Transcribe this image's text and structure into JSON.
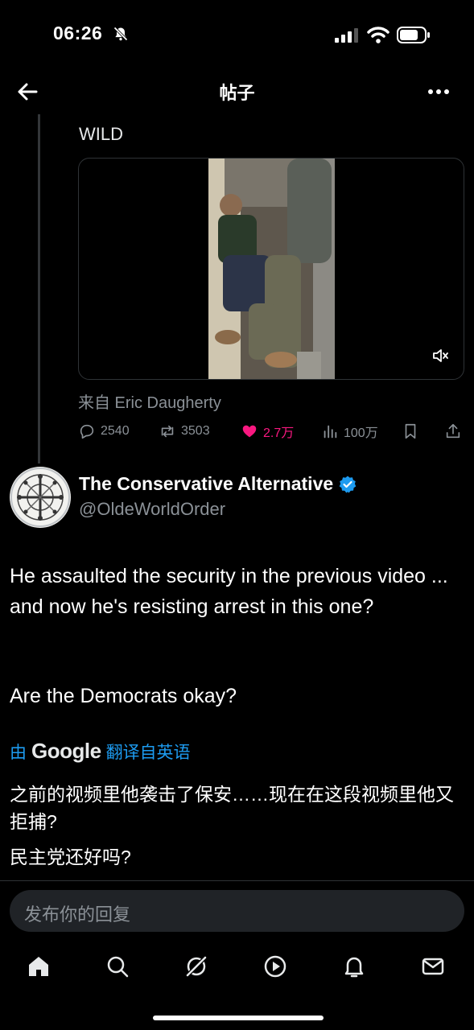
{
  "status": {
    "time": "06:26"
  },
  "header": {
    "title": "帖子"
  },
  "quoted_post": {
    "text": "WILD",
    "source": "来自 Eric Daugherty",
    "stats": {
      "replies": "2540",
      "reposts": "3503",
      "likes": "2.7万",
      "views": "100万"
    }
  },
  "post": {
    "author_name": "The Conservative Alternative",
    "author_handle": "@OldeWorldOrder",
    "body_p1": "He assaulted the security in the previous video ... and now he's resisting arrest in this one?",
    "body_p2": "Are the Democrats okay?",
    "translate_prefix": "由",
    "translate_brand": "Google",
    "translate_suffix": "翻译自英语",
    "translated_p1": "之前的视频里他袭击了保安……现在在这段视频里他又拒捕?",
    "translated_p2": "民主党还好吗?"
  },
  "reply": {
    "placeholder": "发布你的回复"
  },
  "colors": {
    "background": "#000000",
    "accent_blue": "#1d9bf0",
    "like_pink": "#f91880",
    "muted_text": "#8b9197"
  },
  "icons": [
    "back-icon",
    "more-icon",
    "mute-icon",
    "reply-icon",
    "repost-icon",
    "like-icon",
    "views-icon",
    "bookmark-icon",
    "share-icon",
    "verified-icon",
    "home-icon",
    "search-icon",
    "grok-icon",
    "video-icon",
    "notifications-icon",
    "messages-icon"
  ]
}
